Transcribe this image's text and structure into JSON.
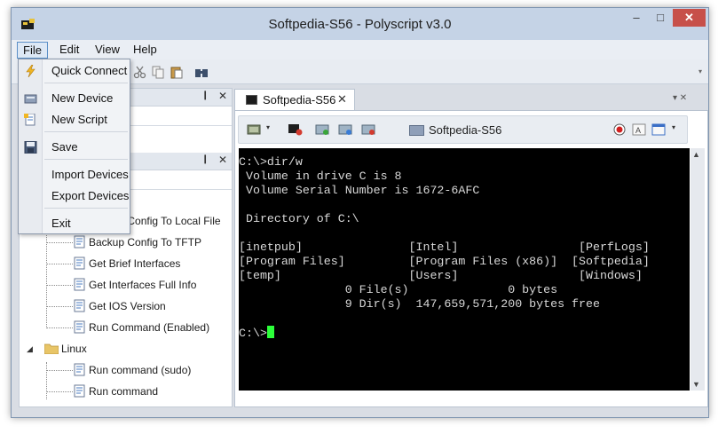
{
  "window": {
    "title": "Softpedia-S56 - Polyscript v3.0",
    "min_glyph": "–",
    "max_glyph": "□",
    "close_glyph": "✕"
  },
  "menubar": {
    "items": [
      "File",
      "Edit",
      "View",
      "Help"
    ]
  },
  "file_menu": {
    "items": [
      "Quick Connect",
      "New Device",
      "New Script",
      "Save",
      "Import Devices",
      "Export Devices",
      "Exit"
    ]
  },
  "tree": {
    "items": [
      "Backup Config To Local File",
      "Backup Config To TFTP",
      "Get Brief Interfaces",
      "Get Interfaces Full Info",
      "Get IOS Version",
      "Run Command (Enabled)"
    ],
    "linux_folder": "Linux",
    "linux_items": [
      "Run command (sudo)",
      "Run command"
    ]
  },
  "panels": {
    "pin_glyph": "❙",
    "close_glyph": "✕"
  },
  "tab": {
    "label": "Softpedia-S56",
    "close_glyph": "✕"
  },
  "session": {
    "label": "Softpedia-S56"
  },
  "terminal": {
    "lines": [
      "C:\\>dir/w",
      " Volume in drive C is 8",
      " Volume Serial Number is 1672-6AFC",
      "",
      " Directory of C:\\",
      "",
      "[inetpub]               [Intel]                 [PerfLogs]",
      "[Program Files]         [Program Files (x86)]  [Softpedia]",
      "[temp]                  [Users]                 [Windows]",
      "               0 File(s)              0 bytes",
      "               9 Dir(s)  147,659,571,200 bytes free",
      ""
    ],
    "prompt": "C:\\>"
  },
  "colors": {
    "titlebar": "#c5d3e6",
    "close_button": "#c7504a",
    "terminal_bg": "#000000",
    "cursor": "#2cff3a"
  }
}
